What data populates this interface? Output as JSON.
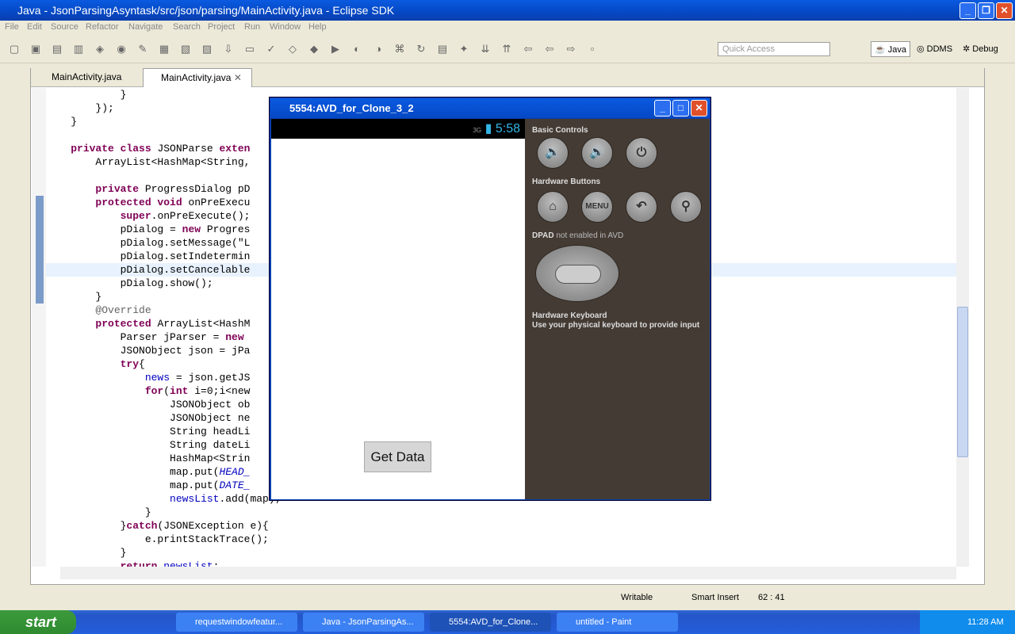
{
  "window": {
    "title": "Java - JsonParsingAsyntask/src/json/parsing/MainActivity.java - Eclipse SDK"
  },
  "menu": [
    "File",
    "Edit",
    "Source",
    "Refactor",
    "Navigate",
    "Search",
    "Project",
    "Run",
    "Window",
    "Help"
  ],
  "toolbar": {
    "quick_access_placeholder": "Quick Access",
    "perspectives": [
      "Java",
      "DDMS",
      "Debug"
    ]
  },
  "editor_tabs": [
    {
      "label": "MainActivity.java",
      "active": false
    },
    {
      "label": "MainActivity.java",
      "active": true
    }
  ],
  "code": {
    "lines": [
      [
        [
          "",
          "            }"
        ]
      ],
      [
        [
          "",
          "        });"
        ]
      ],
      [
        [
          "",
          "    }"
        ]
      ],
      [
        [
          "",
          ""
        ]
      ],
      [
        [
          "",
          "    "
        ],
        [
          "kw",
          "private class"
        ],
        [
          "",
          " JSONParse "
        ],
        [
          "kw",
          "exten"
        ]
      ],
      [
        [
          "",
          "        ArrayList<HashMap<String,"
        ]
      ],
      [
        [
          "",
          ""
        ]
      ],
      [
        [
          "",
          "        "
        ],
        [
          "kw",
          "private"
        ],
        [
          "",
          " ProgressDialog pD"
        ]
      ],
      [
        [
          "",
          "        "
        ],
        [
          "kw",
          "protected void"
        ],
        [
          "",
          " onPreExecu"
        ]
      ],
      [
        [
          "",
          "            "
        ],
        [
          "kw",
          "super"
        ],
        [
          "",
          ".onPreExecute();"
        ]
      ],
      [
        [
          "",
          "            pDialog = "
        ],
        [
          "kw",
          "new"
        ],
        [
          "",
          " Progres"
        ]
      ],
      [
        [
          "",
          "            pDialog.setMessage(\"L"
        ]
      ],
      [
        [
          "",
          "            pDialog.setIndetermin"
        ]
      ],
      [
        [
          "",
          "            pDialog.setCancelable"
        ]
      ],
      [
        [
          "",
          "            pDialog.show();"
        ]
      ],
      [
        [
          "",
          "        }"
        ]
      ],
      [
        [
          "ann",
          "        @Override"
        ]
      ],
      [
        [
          "",
          "        "
        ],
        [
          "kw",
          "protected"
        ],
        [
          "",
          " ArrayList<HashM"
        ]
      ],
      [
        [
          "",
          "            Parser jParser = "
        ],
        [
          "kw",
          "new"
        ]
      ],
      [
        [
          "",
          "            JSONObject json = jPa"
        ]
      ],
      [
        [
          "",
          "            "
        ],
        [
          "kw",
          "try"
        ],
        [
          "",
          "{"
        ]
      ],
      [
        [
          "",
          "                "
        ],
        [
          "fld",
          "news"
        ],
        [
          "",
          " = json.getJS"
        ]
      ],
      [
        [
          "",
          "                "
        ],
        [
          "kw",
          "for"
        ],
        [
          "",
          "("
        ],
        [
          "kw",
          "int"
        ],
        [
          "",
          " i=0;i<new"
        ]
      ],
      [
        [
          "",
          "                    JSONObject ob"
        ]
      ],
      [
        [
          "",
          "                    JSONObject ne"
        ]
      ],
      [
        [
          "",
          "                    String headLi"
        ]
      ],
      [
        [
          "",
          "                    String dateLi"
        ]
      ],
      [
        [
          "",
          "                    HashMap<Strin"
        ]
      ],
      [
        [
          "",
          "                    map.put("
        ],
        [
          "it",
          "HEAD_"
        ]
      ],
      [
        [
          "",
          "                    map.put("
        ],
        [
          "it",
          "DATE_"
        ]
      ],
      [
        [
          "",
          "                    "
        ],
        [
          "fld",
          "newsList"
        ],
        [
          "",
          ".add(map);"
        ]
      ],
      [
        [
          "",
          "                }"
        ]
      ],
      [
        [
          "",
          "            }"
        ],
        [
          "kw",
          "catch"
        ],
        [
          "",
          "(JSONException e){"
        ]
      ],
      [
        [
          "",
          "                e.printStackTrace();"
        ]
      ],
      [
        [
          "",
          "            }"
        ]
      ],
      [
        [
          "",
          "            "
        ],
        [
          "kw",
          "return"
        ],
        [
          "",
          " "
        ],
        [
          "fld",
          "newsList"
        ],
        [
          "",
          ";"
        ]
      ]
    ],
    "highlight_line": 13
  },
  "status": {
    "writable": "Writable",
    "insert_mode": "Smart Insert",
    "position": "62 : 41"
  },
  "emulator": {
    "title": "5554:AVD_for_Clone_3_2",
    "network": "3G",
    "time": "5:58",
    "button": "Get Data",
    "basic_controls": "Basic Controls",
    "hardware_buttons": "Hardware Buttons",
    "menu_label": "MENU",
    "dpad_label": "DPAD",
    "dpad_note": "not enabled in AVD",
    "keyboard_title": "Hardware Keyboard",
    "keyboard_note": "Use your physical keyboard to provide input"
  },
  "taskbar": {
    "start": "start",
    "tasks": [
      {
        "label": "requestwindowfeatur...",
        "active": false
      },
      {
        "label": "Java - JsonParsingAs...",
        "active": false
      },
      {
        "label": "5554:AVD_for_Clone...",
        "active": true
      },
      {
        "label": "untitled - Paint",
        "active": false
      }
    ],
    "clock": "11:28 AM"
  }
}
